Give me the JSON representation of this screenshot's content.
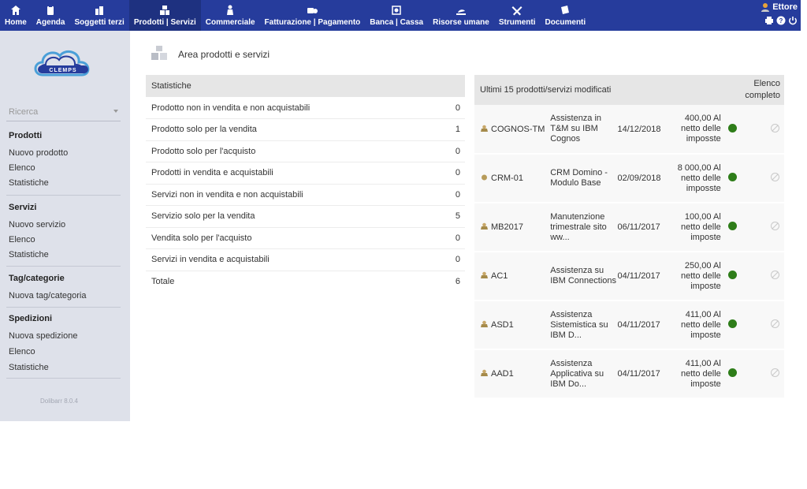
{
  "nav": {
    "items": [
      {
        "label": "Home",
        "icon": "home-icon"
      },
      {
        "label": "Agenda",
        "icon": "agenda-icon"
      },
      {
        "label": "Soggetti terzi",
        "icon": "building-icon"
      },
      {
        "label": "Prodotti | Servizi",
        "icon": "boxes-icon",
        "active": true
      },
      {
        "label": "Commerciale",
        "icon": "commercial-icon"
      },
      {
        "label": "Fatturazione | Pagamento",
        "icon": "billing-icon"
      },
      {
        "label": "Banca | Cassa",
        "icon": "bank-icon"
      },
      {
        "label": "Risorse umane",
        "icon": "hr-icon"
      },
      {
        "label": "Strumenti",
        "icon": "tools-icon"
      },
      {
        "label": "Documenti",
        "icon": "documents-icon"
      }
    ],
    "user": "Ettore"
  },
  "sidebar": {
    "search_placeholder": "Ricerca",
    "sections": [
      {
        "title": "Prodotti",
        "links": [
          "Nuovo prodotto",
          "Elenco",
          "Statistiche"
        ]
      },
      {
        "title": "Servizi",
        "links": [
          "Nuovo servizio",
          "Elenco",
          "Statistiche"
        ]
      },
      {
        "title": "Tag/categorie",
        "links": [
          "Nuova tag/categoria"
        ]
      },
      {
        "title": "Spedizioni",
        "links": [
          "Nuova spedizione",
          "Elenco",
          "Statistiche"
        ]
      }
    ],
    "version": "Dolibarr 8.0.4"
  },
  "page": {
    "title": "Area prodotti e servizi"
  },
  "stats": {
    "header": "Statistiche",
    "rows": [
      {
        "label": "Prodotto non in vendita e non acquistabili",
        "value": "0"
      },
      {
        "label": "Prodotto solo per la vendita",
        "value": "1"
      },
      {
        "label": "Prodotto solo per l'acquisto",
        "value": "0"
      },
      {
        "label": "Prodotti in vendita e acquistabili",
        "value": "0"
      },
      {
        "label": "Servizi non in vendita e non acquistabili",
        "value": "0"
      },
      {
        "label": "Servizio solo per la vendita",
        "value": "5"
      },
      {
        "label": "Vendita solo per l'acquisto",
        "value": "0"
      },
      {
        "label": "Servizi in vendita e acquistabili",
        "value": "0"
      }
    ],
    "total_label": "Totale",
    "total_value": "6"
  },
  "recent": {
    "header": "Ultimi 15 prodotti/servizi modificati",
    "link": "Elenco completo",
    "rows": [
      {
        "ref": "COGNOS-TM",
        "label": "Assistenza in T&M su IBM Cognos",
        "date": "14/12/2018",
        "price": "400,00 Al netto delle imposste"
      },
      {
        "ref": "CRM-01",
        "label": "CRM Domino - Modulo Base",
        "date": "02/09/2018",
        "price": "8 000,00 Al netto delle imposste"
      },
      {
        "ref": "MB2017",
        "label": "Manutenzione trimestrale sito ww...",
        "date": "06/11/2017",
        "price": "100,00 Al netto delle imposte"
      },
      {
        "ref": "AC1",
        "label": "Assistenza su IBM Connections",
        "date": "04/11/2017",
        "price": "250,00 Al netto delle imposte"
      },
      {
        "ref": "ASD1",
        "label": "Assistenza Sistemistica su IBM D...",
        "date": "04/11/2017",
        "price": "411,00 Al netto delle imposte"
      },
      {
        "ref": "AAD1",
        "label": "Assistenza Applicativa su IBM Do...",
        "date": "04/11/2017",
        "price": "411,00 Al netto delle imposte"
      }
    ]
  }
}
